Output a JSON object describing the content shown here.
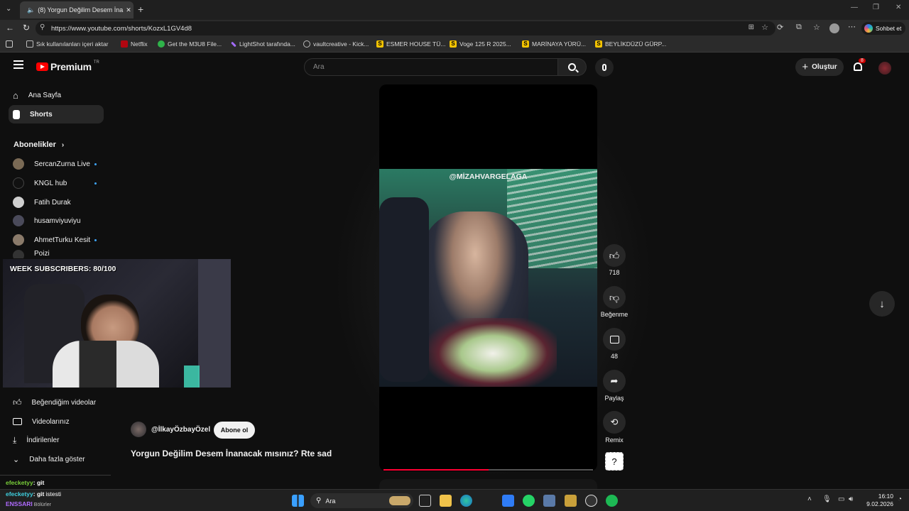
{
  "browser": {
    "tab_title": "(8) Yorgun Değilim Desem İna",
    "new_tab_symbol": "+",
    "url": "https://www.youtube.com/shorts/KozxL1GV4d8",
    "chat_button": "Sohbet et",
    "bookmarks": [
      "Sık kullanılanları içeri aktar",
      "Netflix",
      "Get the M3U8 File...",
      "LightShot tarafında...",
      "vaultcreative - Kick...",
      "ESMER HOUSE TÜ...",
      "Voge 125 R 2025...",
      "MARİNAYA YÜRÜ...",
      "BEYLİKDÜZÜ GÜRP..."
    ]
  },
  "youtube": {
    "logo_text": "Premium",
    "logo_badge": "TR",
    "search_placeholder": "Ara",
    "create_label": "Oluştur",
    "notification_count": "8",
    "sidebar": {
      "home": "Ana Sayfa",
      "shorts": "Shorts",
      "subscriptions_header": "Abonelikler",
      "subscriptions": [
        "SercanZurna Live",
        "KNGL hub",
        "Fatih Durak",
        "husamviyuviyu",
        "AhmetTurku Kesit",
        "Poizi"
      ],
      "liked": "Beğendiğim videolar",
      "your_videos": "Videolarınız",
      "downloads": "İndirilenler",
      "show_more": "Daha fazla göster"
    },
    "short": {
      "watermark": "@MİZAHVARGELAGA",
      "channel": "@İlkayÖzbayÖzel",
      "subscribe": "Abone ol",
      "title": "Yorgun Değilim Desem İnanacak mısınız? Rte sad",
      "progress": 0.5
    },
    "actions": {
      "like_count": "718",
      "dislike_label": "Beğenme",
      "comment_count": "48",
      "share_label": "Paylaş",
      "remix_label": "Remix"
    }
  },
  "stream_overlay": {
    "goal_text": "WEEK SUBSCRIBERS: 80/100",
    "chat": [
      {
        "user": "efecketyy",
        "message": ": git"
      },
      {
        "user": "efecketyy",
        "message": ": git"
      },
      {
        "user": "ENSSARI",
        "message": ""
      }
    ],
    "chat_extra_1": "istesti",
    "chat_extra_2": "Bölürler"
  },
  "taskbar": {
    "search_label": "Ara",
    "time": "16:10",
    "date": "9.02.2026"
  },
  "colors": {
    "youtube_red": "#ff0000",
    "chat_user_green": "#7ad03a",
    "chat_user_cyan": "#3fd0e0",
    "chat_user_purple": "#b06bff",
    "progress_red": "#ff0033"
  }
}
